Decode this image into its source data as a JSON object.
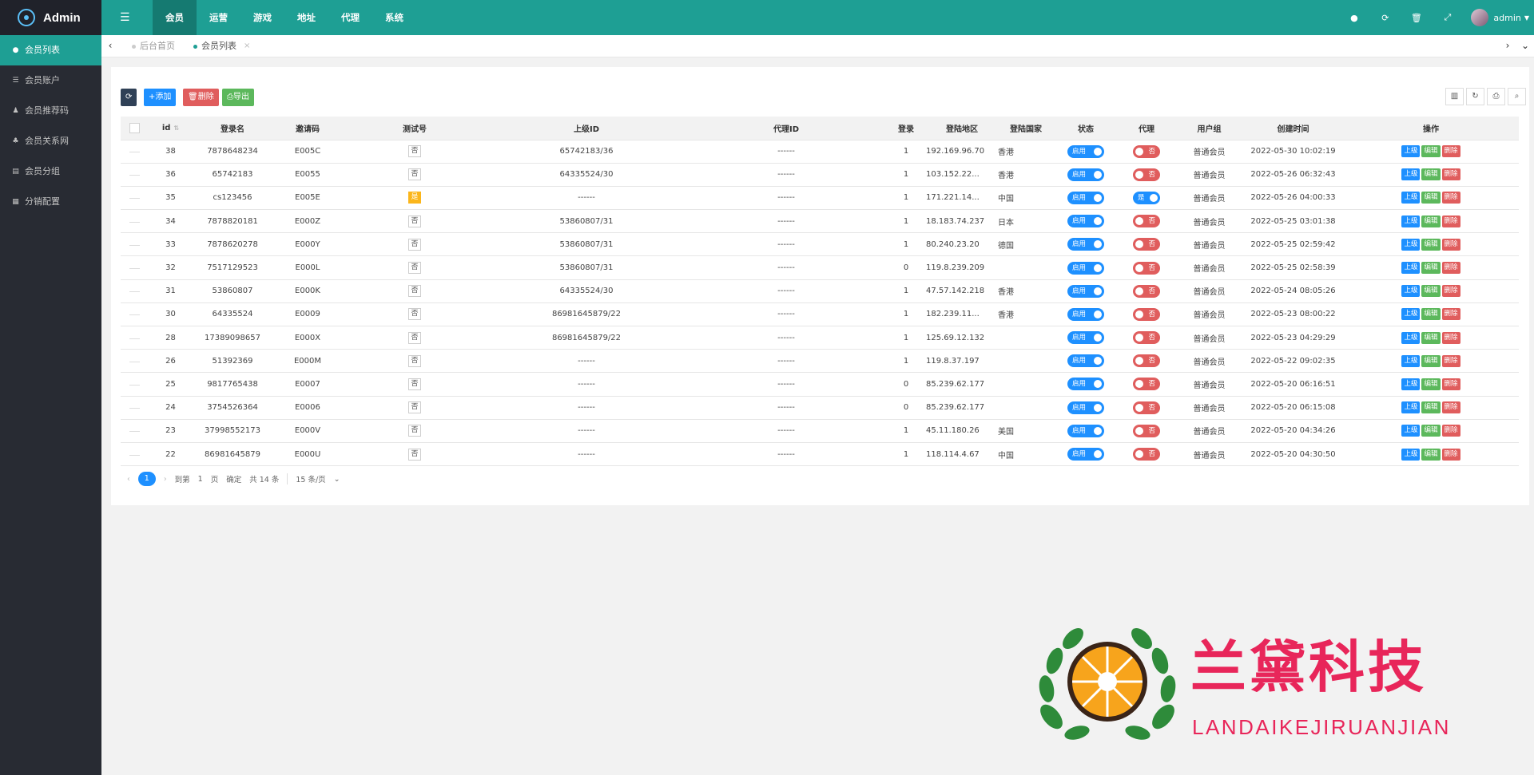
{
  "header": {
    "app_name": "Admin",
    "menu_icon": "hamburger-icon",
    "nav": [
      "会员",
      "运营",
      "游戏",
      "地址",
      "代理",
      "系统"
    ],
    "tools": [
      "theme-icon",
      "refresh-icon",
      "trash-icon",
      "fullscreen-icon"
    ],
    "user": "admin"
  },
  "sidebar": {
    "items": [
      {
        "label": "会员列表",
        "icon": "user-icon"
      },
      {
        "label": "会员账户",
        "icon": "list-icon"
      },
      {
        "label": "会员推荐码",
        "icon": "user-plus-icon"
      },
      {
        "label": "会员关系网",
        "icon": "users-icon"
      },
      {
        "label": "会员分组",
        "icon": "group-icon"
      },
      {
        "label": "分销配置",
        "icon": "file-icon"
      }
    ]
  },
  "tabs": [
    {
      "label": "后台首页"
    },
    {
      "label": "会员列表"
    }
  ],
  "toolbar": {
    "add": "+添加",
    "delete": "删除",
    "export": "导出"
  },
  "table": {
    "columns": [
      "id",
      "登录名",
      "邀请码",
      "测试号",
      "上级ID",
      "代理ID",
      "登录",
      "登陆地区",
      "登陆国家",
      "状态",
      "代理",
      "用户组",
      "创建时间",
      "操作"
    ],
    "rows": [
      {
        "id": "38",
        "login": "7878648234",
        "code": "E005C",
        "test": "否",
        "parent": "65742183/36",
        "agent": "------",
        "logins": "1",
        "ip": "192.169.96.70",
        "country": "香港",
        "status": "启用",
        "proxy": "否",
        "group": "普通会员",
        "created": "2022-05-30 10:02:19"
      },
      {
        "id": "36",
        "login": "65742183",
        "code": "E0055",
        "test": "否",
        "parent": "64335524/30",
        "agent": "------",
        "logins": "1",
        "ip": "103.152.22...",
        "country": "香港",
        "status": "启用",
        "proxy": "否",
        "group": "普通会员",
        "created": "2022-05-26 06:32:43"
      },
      {
        "id": "35",
        "login": "cs123456",
        "code": "E005E",
        "test": "是",
        "parent": "------",
        "agent": "------",
        "logins": "1",
        "ip": "171.221.14...",
        "country": "中国",
        "status": "启用",
        "proxy": "是",
        "group": "普通会员",
        "created": "2022-05-26 04:00:33"
      },
      {
        "id": "34",
        "login": "7878820181",
        "code": "E000Z",
        "test": "否",
        "parent": "53860807/31",
        "agent": "------",
        "logins": "1",
        "ip": "18.183.74.237",
        "country": "日本",
        "status": "启用",
        "proxy": "否",
        "group": "普通会员",
        "created": "2022-05-25 03:01:38"
      },
      {
        "id": "33",
        "login": "7878620278",
        "code": "E000Y",
        "test": "否",
        "parent": "53860807/31",
        "agent": "------",
        "logins": "1",
        "ip": "80.240.23.20",
        "country": "德国",
        "status": "启用",
        "proxy": "否",
        "group": "普通会员",
        "created": "2022-05-25 02:59:42"
      },
      {
        "id": "32",
        "login": "7517129523",
        "code": "E000L",
        "test": "否",
        "parent": "53860807/31",
        "agent": "------",
        "logins": "0",
        "ip": "119.8.239.209",
        "country": "",
        "status": "启用",
        "proxy": "否",
        "group": "普通会员",
        "created": "2022-05-25 02:58:39"
      },
      {
        "id": "31",
        "login": "53860807",
        "code": "E000K",
        "test": "否",
        "parent": "64335524/30",
        "agent": "------",
        "logins": "1",
        "ip": "47.57.142.218",
        "country": "香港",
        "status": "启用",
        "proxy": "否",
        "group": "普通会员",
        "created": "2022-05-24 08:05:26"
      },
      {
        "id": "30",
        "login": "64335524",
        "code": "E0009",
        "test": "否",
        "parent": "86981645879/22",
        "agent": "------",
        "logins": "1",
        "ip": "182.239.11...",
        "country": "香港",
        "status": "启用",
        "proxy": "否",
        "group": "普通会员",
        "created": "2022-05-23 08:00:22"
      },
      {
        "id": "28",
        "login": "17389098657",
        "code": "E000X",
        "test": "否",
        "parent": "86981645879/22",
        "agent": "------",
        "logins": "1",
        "ip": "125.69.12.132",
        "country": "",
        "status": "启用",
        "proxy": "否",
        "group": "普通会员",
        "created": "2022-05-23 04:29:29"
      },
      {
        "id": "26",
        "login": "51392369",
        "code": "E000M",
        "test": "否",
        "parent": "------",
        "agent": "------",
        "logins": "1",
        "ip": "119.8.37.197",
        "country": "",
        "status": "启用",
        "proxy": "否",
        "group": "普通会员",
        "created": "2022-05-22 09:02:35"
      },
      {
        "id": "25",
        "login": "9817765438",
        "code": "E0007",
        "test": "否",
        "parent": "------",
        "agent": "------",
        "logins": "0",
        "ip": "85.239.62.177",
        "country": "",
        "status": "启用",
        "proxy": "否",
        "group": "普通会员",
        "created": "2022-05-20 06:16:51"
      },
      {
        "id": "24",
        "login": "3754526364",
        "code": "E0006",
        "test": "否",
        "parent": "------",
        "agent": "------",
        "logins": "0",
        "ip": "85.239.62.177",
        "country": "",
        "status": "启用",
        "proxy": "否",
        "group": "普通会员",
        "created": "2022-05-20 06:15:08"
      },
      {
        "id": "23",
        "login": "37998552173",
        "code": "E000V",
        "test": "否",
        "parent": "------",
        "agent": "------",
        "logins": "1",
        "ip": "45.11.180.26",
        "country": "美国",
        "status": "启用",
        "proxy": "否",
        "group": "普通会员",
        "created": "2022-05-20 04:34:26"
      },
      {
        "id": "22",
        "login": "86981645879",
        "code": "E000U",
        "test": "否",
        "parent": "------",
        "agent": "------",
        "logins": "1",
        "ip": "118.114.4.67",
        "country": "中国",
        "status": "启用",
        "proxy": "否",
        "group": "普通会员",
        "created": "2022-05-20 04:30:50"
      }
    ],
    "actions": [
      "上级",
      "编辑",
      "删除"
    ]
  },
  "pager": {
    "current": "1",
    "goto_label": "到第",
    "goto_value": "1",
    "page_unit": "页",
    "confirm": "确定",
    "total": "共 14 条",
    "per_page": "15 条/页"
  },
  "watermark": {
    "cn": "兰黛科技",
    "en": "LANDAIKEJIRUANJIAN"
  },
  "colors": {
    "primary": "#1e9f94",
    "sidebar": "#282b33",
    "blue": "#1e90ff",
    "red": "#e05d5d",
    "green": "#5cb85c",
    "brand_pink": "#e8265a"
  }
}
